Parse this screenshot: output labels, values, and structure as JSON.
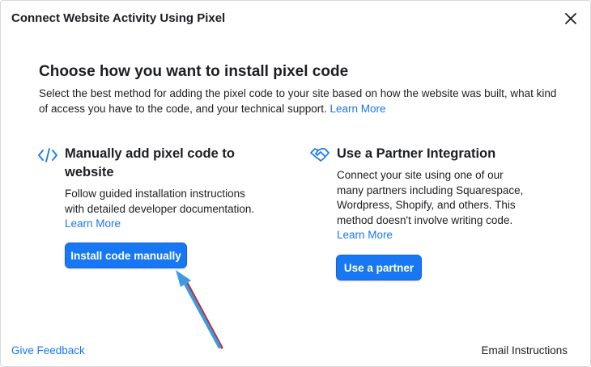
{
  "dialog": {
    "title": "Connect Website Activity Using Pixel",
    "close_icon": "close-icon"
  },
  "section": {
    "title": "Choose how you want to install pixel code",
    "description": "Select the best method for adding the pixel code to your site based on how the website was built, what kind of access you have to the code, and your technical support. ",
    "learn_more": "Learn More"
  },
  "options": [
    {
      "icon": "code-icon",
      "title": "Manually add pixel code to website",
      "description": "Follow guided installation instructions with detailed developer documentation.",
      "learn_more": "Learn More",
      "button_label": "Install code manually"
    },
    {
      "icon": "handshake-icon",
      "title": "Use a Partner Integration",
      "description": "Connect your site using one of our many partners including Squarespace, Wordpress, Shopify, and others. This method doesn't involve writing code.",
      "learn_more": "Learn More",
      "button_label": "Use a partner"
    }
  ],
  "footer": {
    "give_feedback": "Give Feedback",
    "email_instructions": "Email Instructions"
  },
  "colors": {
    "accent": "#1877f2",
    "text": "#1c1e21",
    "annotation_arrow": "#3b9ae1"
  }
}
